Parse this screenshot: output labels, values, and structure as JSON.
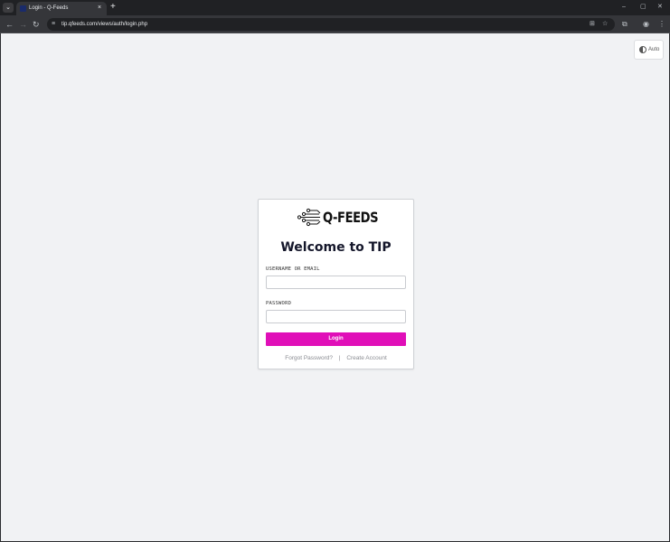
{
  "browser": {
    "tab": {
      "title": "Login - Q-Feeds",
      "close_glyph": "×"
    },
    "new_tab_glyph": "+",
    "tab_search_glyph": "⌄",
    "window_controls": {
      "minimize": "–",
      "maximize": "▢",
      "close": "✕"
    },
    "nav": {
      "back": "←",
      "forward": "→",
      "reload": "↻"
    },
    "url": "tip.qfeeds.com/views/auth/login.php",
    "icons": {
      "site_info": "≡",
      "translate": "⊞",
      "bookmark": "☆",
      "extensions": "⧉",
      "profile": "◉",
      "menu": "⋮"
    }
  },
  "page": {
    "theme_toggle": {
      "label": "Auto"
    },
    "brand": {
      "logo_text": "Q-FEEDS"
    },
    "heading": "Welcome to TIP",
    "form": {
      "username_label": "USERNAME OR EMAIL",
      "username_value": "",
      "password_label": "PASSWORD",
      "password_value": "",
      "submit_label": "Login"
    },
    "links": {
      "forgot_password": "Forgot Password?",
      "separator": "|",
      "create_account": "Create Account"
    },
    "colors": {
      "accent": "#e00fb8",
      "heading": "#14162a",
      "background": "#f1f2f4"
    }
  }
}
